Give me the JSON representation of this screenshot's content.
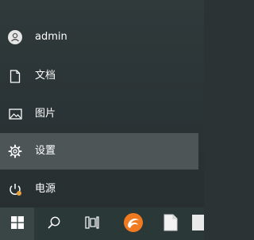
{
  "start_menu": {
    "items": [
      {
        "label": "admin",
        "icon": "user-avatar-icon"
      },
      {
        "label": "文档",
        "icon": "document-icon"
      },
      {
        "label": "图片",
        "icon": "picture-icon"
      },
      {
        "label": "设置",
        "icon": "gear-icon",
        "hovered": true
      },
      {
        "label": "电源",
        "icon": "power-icon",
        "accent": "#e8a23a"
      }
    ]
  },
  "taskbar": {
    "buttons": [
      {
        "icon": "windows-start-icon"
      },
      {
        "icon": "search-icon"
      },
      {
        "icon": "task-view-icon"
      },
      {
        "icon": "browser-app-icon",
        "color": "#f07a20"
      },
      {
        "icon": "notepad-icon"
      },
      {
        "icon": "generic-app-icon"
      }
    ]
  }
}
